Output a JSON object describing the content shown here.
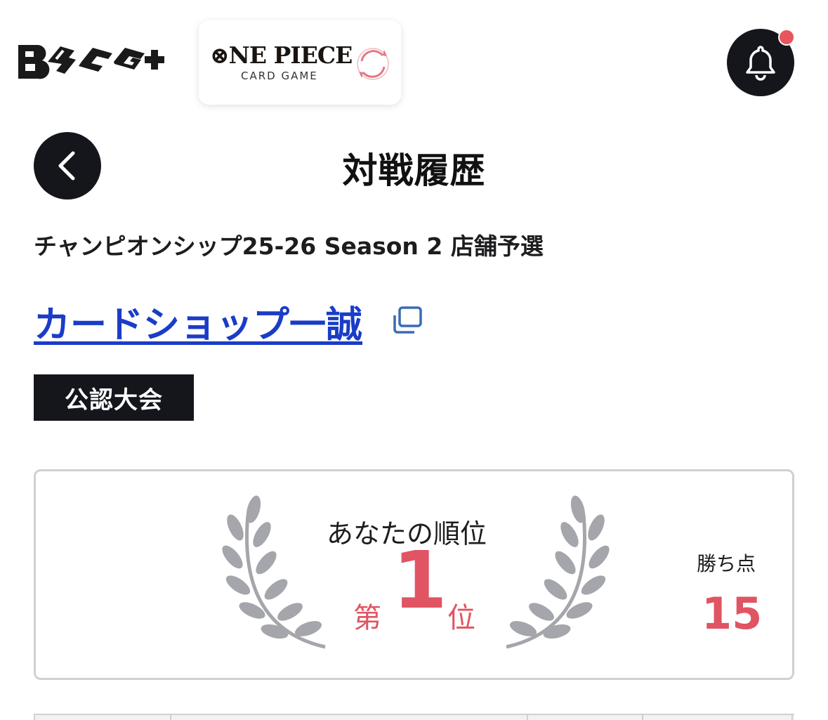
{
  "header": {
    "brand_logo_text": "B TCG+",
    "game_logo": {
      "title": "⊗NE PIECE",
      "subtitle": "CARD GAME"
    },
    "notification_icon": "bell-icon",
    "notification_dot_color": "#e8555f"
  },
  "title_bar": {
    "back_icon": "chevron-left-icon",
    "title": "対戦履歴"
  },
  "event": {
    "name": "チャンピオンシップ25-26 Season 2 店舗予選",
    "shop_name": "カードショップ一誠",
    "external_icon": "external-link-icon",
    "badge": "公認大会"
  },
  "result": {
    "rank_label": "あなたの順位",
    "rank_prefix": "第",
    "rank_value": "1",
    "rank_suffix": "位",
    "points_label": "勝ち点",
    "points_value": "15",
    "accent_color": "#e05463"
  }
}
